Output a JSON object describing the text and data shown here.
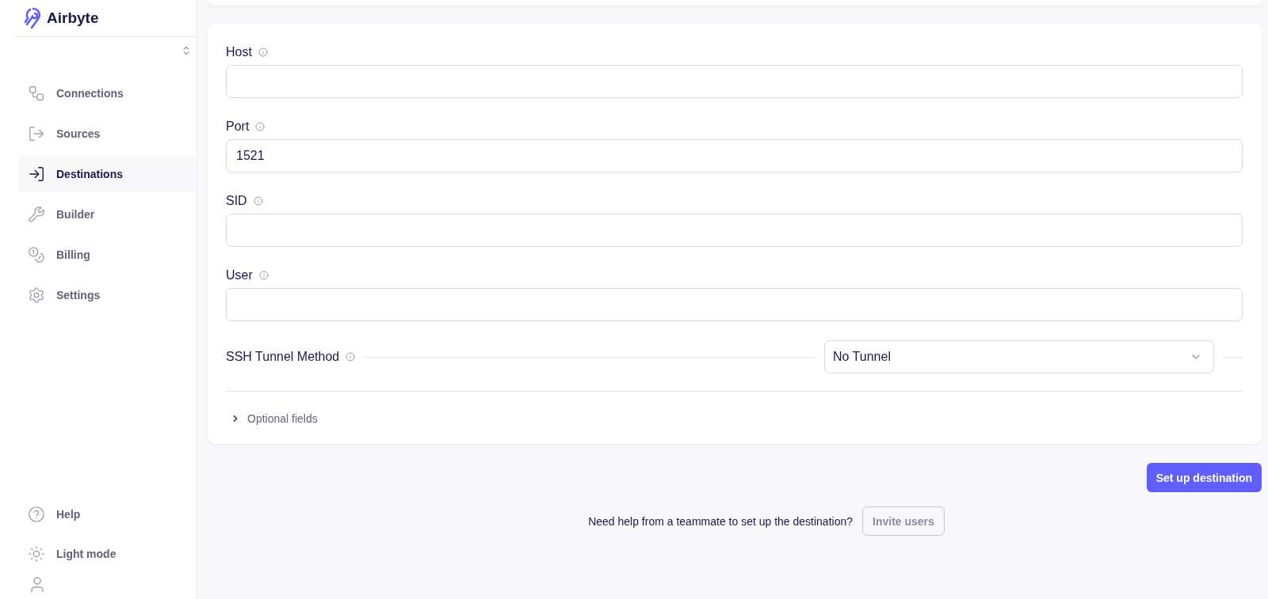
{
  "sidebar": {
    "logo": "Airbyte",
    "nav": [
      {
        "label": "Connections",
        "kind": "connections",
        "selected": false
      },
      {
        "label": "Sources",
        "kind": "sources",
        "selected": false
      },
      {
        "label": "Destinations",
        "kind": "destinations",
        "selected": true
      },
      {
        "label": "Builder",
        "kind": "builder",
        "selected": false
      },
      {
        "label": "Billing",
        "kind": "billing",
        "selected": false
      },
      {
        "label": "Settings",
        "kind": "settings",
        "selected": false
      }
    ],
    "bottom": [
      {
        "label": "Help",
        "kind": "help"
      },
      {
        "label": "Light mode",
        "kind": "light"
      }
    ]
  },
  "form": {
    "fields": [
      {
        "kind": "text",
        "label": "Host"
      },
      {
        "kind": "text",
        "label": "Port",
        "value": "1521"
      },
      {
        "kind": "text",
        "label": "SID"
      },
      {
        "kind": "text",
        "label": "User"
      },
      {
        "kind": "select",
        "label": "SSH Tunnel Method",
        "value": "No Tunnel"
      }
    ],
    "optional": {
      "label": "Optional fields",
      "expanded": false
    }
  },
  "submit": "Set up destination",
  "invite": {
    "text": "Need help from a teammate to set up the destination?",
    "button": "Invite users"
  }
}
